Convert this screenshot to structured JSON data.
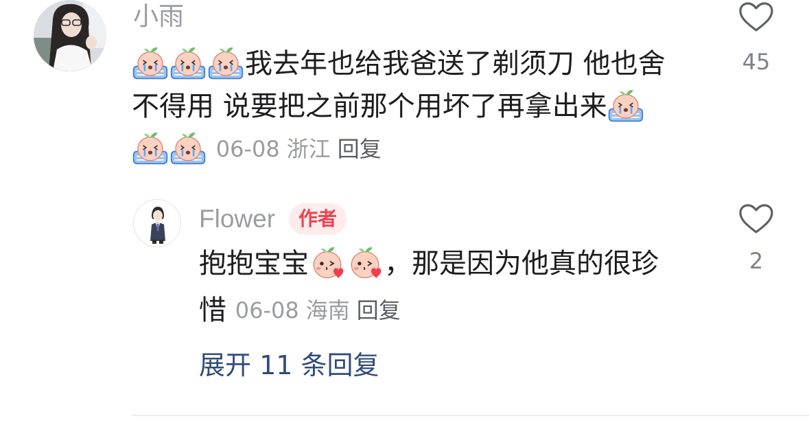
{
  "comment": {
    "user_name": "小雨",
    "text_line1": "我去年也给我爸送了剃须刀 他也舍",
    "text_line2": "不得用 说要把之前那个用坏了再拿出来",
    "date": "06-08",
    "location": "浙江",
    "reply_label": "回复",
    "likes": "45",
    "emoji_leading": "crying-face-emoji",
    "emoji_trailing": "crying-face-emoji"
  },
  "reply": {
    "user_name": "Flower",
    "badge": "作者",
    "text_part1": "抱抱宝宝",
    "text_part2": "，那是因为他真的很珍",
    "text_part3": "惜",
    "date": "06-08",
    "location": "海南",
    "reply_label": "回复",
    "likes": "2",
    "emoji": "kiss-heart-emoji"
  },
  "expand_label": "展开 11 条回复",
  "colors": {
    "text": "#1d1d1f",
    "meta": "#9a9ca1",
    "author_badge_bg": "#fdeceb",
    "author_badge_text": "#e9434e",
    "expand_link": "#2f4c7a"
  }
}
